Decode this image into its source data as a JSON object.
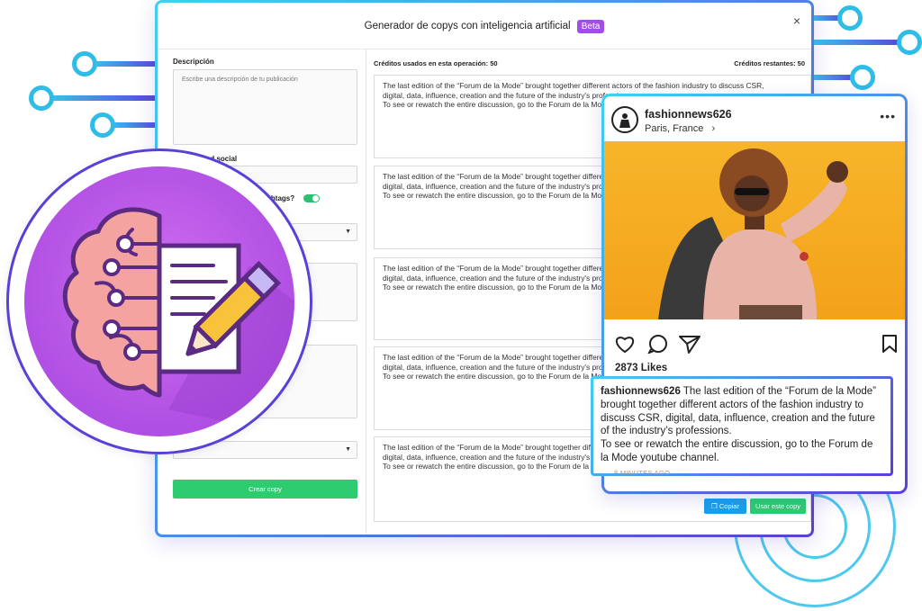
{
  "colors": {
    "accent_cyan": "#38c6ee",
    "accent_purple": "#5a3fd8",
    "beta": "#a14fe0",
    "green": "#2ecc71",
    "blue": "#1aa0ea",
    "brain_bg": "#b04fe3"
  },
  "modal": {
    "title": "Generador de copys con inteligencia artificial",
    "badge": "Beta",
    "close": "×"
  },
  "form": {
    "description_label": "Descripción",
    "description_placeholder": "Escribe una descripción de tu publicación",
    "network_label": "¿En qué red social",
    "hashtags_label": "ashtags?",
    "create_button": "Crear copy"
  },
  "results": {
    "credits_used": "Créditos usados en esta operación: 50",
    "credits_left": "Créditos restantes: 50",
    "copy_text_1": "The last edition of the “Forum de la Mode” brought together different actors of the fashion industry to discuss CSR,",
    "copy_text_2": "digital, data, influence, creation and the future of the industry's professions.",
    "copy_text_3": "To see or rewatch the entire discussion, go to the Forum de la Mode youtube channel.",
    "copy_button": "Copiar",
    "use_button": "Usar este copy"
  },
  "instagram": {
    "username": "fashionnews626",
    "location": "Paris, France",
    "location_chevron": "›",
    "more": "•••",
    "likes": "2873 Likes",
    "caption_user": "fashionnews626",
    "caption_text": "The last edition of the “Forum de la Mode” brought together different actors of the fashion industry to discuss CSR, digital, data, influence, creation and the future of the industry’s professions.",
    "caption_text_2": "To see or rewatch the entire discussion, go to the Forum de la Mode youtube channel.",
    "time": "8 MINUTES AGO"
  }
}
